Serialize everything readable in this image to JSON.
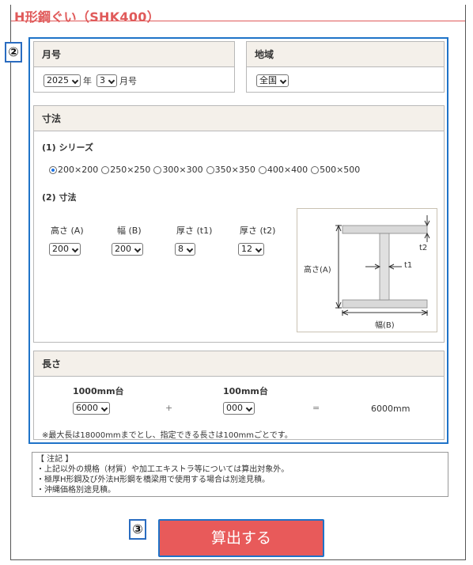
{
  "title": "H形鋼ぐい（SHK400）",
  "markers": {
    "m2": "②",
    "m3": "③"
  },
  "month_panel": {
    "heading": "月号",
    "year_value": "2025",
    "year_suffix": "年",
    "month_value": "3",
    "month_suffix": "月号"
  },
  "region_panel": {
    "heading": "地域",
    "value": "全国"
  },
  "size_panel": {
    "heading": "寸法",
    "series_label": "(1) シリーズ",
    "series_options": [
      "200×200",
      "250×250",
      "300×300",
      "350×350",
      "400×400",
      "500×500"
    ],
    "series_selected": "200×200",
    "dims_label": "(2) 寸法",
    "dims": [
      {
        "label": "高さ (A)",
        "value": "200"
      },
      {
        "label": "幅 (B)",
        "value": "200"
      },
      {
        "label": "厚さ (t1)",
        "value": "8"
      },
      {
        "label": "厚さ (t2)",
        "value": "12"
      }
    ],
    "diagram": {
      "height_label": "高さ(A)",
      "width_label": "幅(B)",
      "t1_label": "t1",
      "t2_label": "t2"
    }
  },
  "length_panel": {
    "heading": "長さ",
    "col1_label": "1000mm台",
    "col1_value": "6000",
    "plus": "+",
    "col2_label": "100mm台",
    "col2_value": "000",
    "equals": "=",
    "result": "6000mm",
    "note": "※最大長は18000mmまでとし、指定できる長さは100mmごとです。"
  },
  "notes": {
    "heading": "【 注記 】",
    "items": [
      "・上記以外の規格（材質）や加工エキストラ等については算出対象外。",
      "・極厚H形鋼及び外法H形鋼を橋梁用で使用する場合は別途見積。",
      "・沖縄価格別途見積。"
    ]
  },
  "calculate_button": "算出する",
  "colors": {
    "accent_red": "#e85a5a",
    "frame_blue": "#1f73c8",
    "panel_head": "#f4f0ea"
  }
}
